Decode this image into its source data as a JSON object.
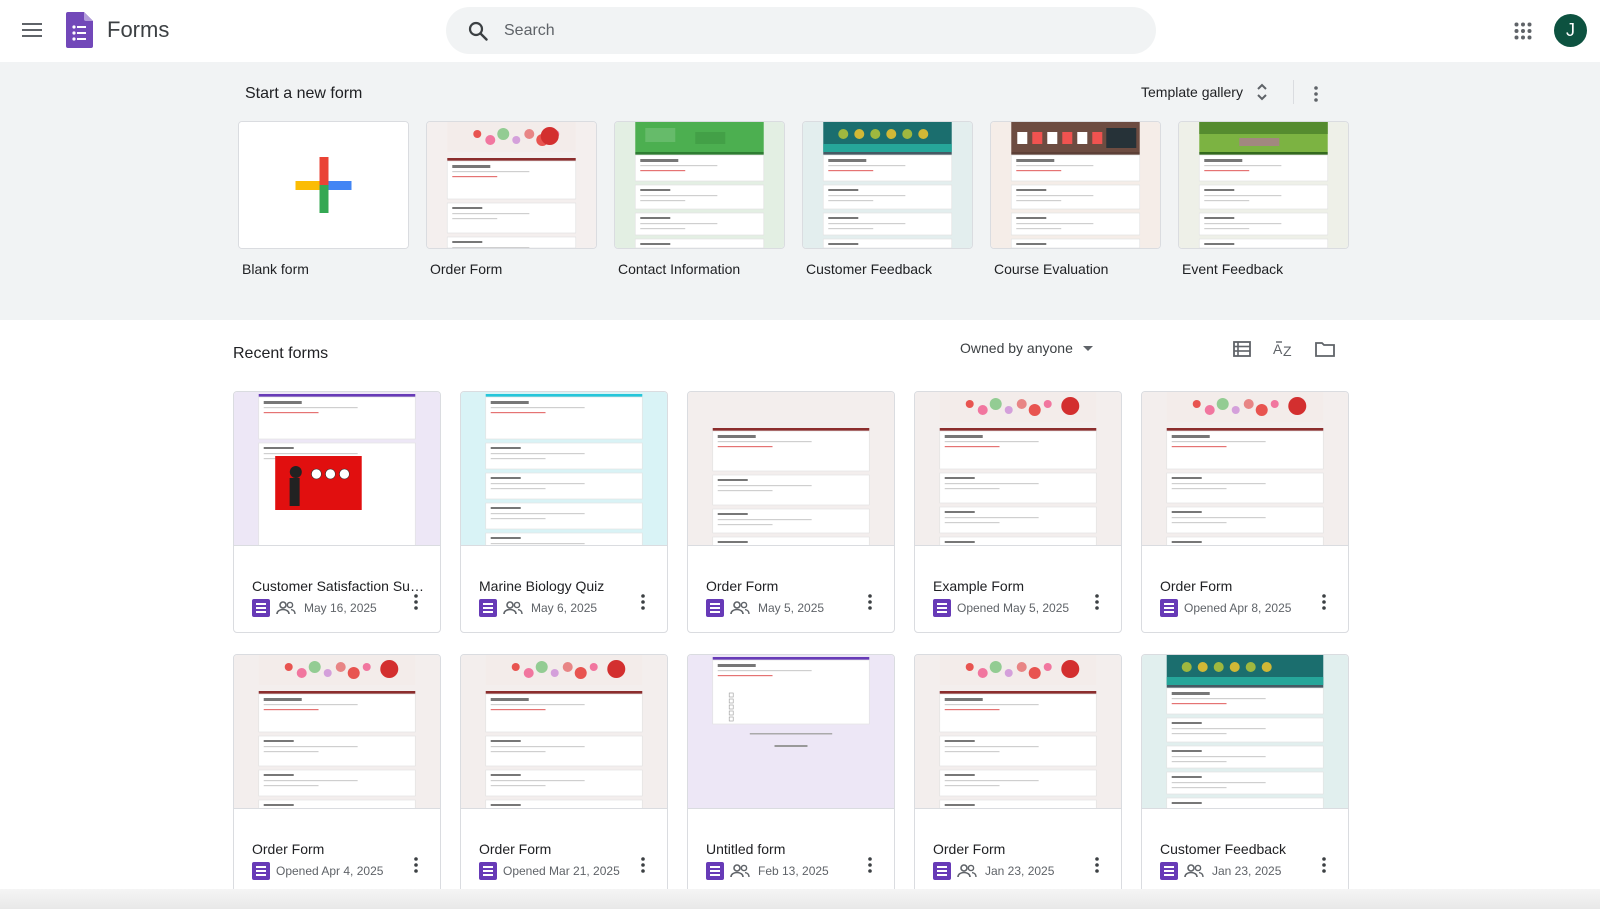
{
  "header": {
    "app_title": "Forms",
    "search_placeholder": "Search",
    "avatar_initial": "J"
  },
  "templates": {
    "heading": "Start a new form",
    "gallery_label": "Template gallery",
    "items": [
      {
        "name": "Blank form",
        "theme": "blank",
        "bg": "#ffffff"
      },
      {
        "name": "Order Form",
        "theme": "floral",
        "bg": "#f4efee"
      },
      {
        "name": "Contact Information",
        "theme": "green",
        "bg": "#e3efe3"
      },
      {
        "name": "Customer Feedback",
        "theme": "teal",
        "bg": "#e3eeee"
      },
      {
        "name": "Course Evaluation",
        "theme": "board",
        "bg": "#f5ede8"
      },
      {
        "name": "Event Feedback",
        "theme": "park",
        "bg": "#eef0e8"
      }
    ]
  },
  "recent": {
    "heading": "Recent forms",
    "owner_filter": "Owned by anyone",
    "forms": [
      {
        "title": "Customer Satisfaction Survey",
        "date": "May 16, 2025",
        "shared": true,
        "theme": "survey"
      },
      {
        "title": "Marine Biology Quiz",
        "date": "May 6, 2025",
        "shared": true,
        "theme": "quiz"
      },
      {
        "title": "Order Form",
        "date": "May 5, 2025",
        "shared": true,
        "theme": "order-plain"
      },
      {
        "title": "Example Form",
        "date": "Opened May 5, 2025",
        "shared": false,
        "theme": "floral"
      },
      {
        "title": "Order Form",
        "date": "Opened Apr 8, 2025",
        "shared": false,
        "theme": "floral"
      },
      {
        "title": "Order Form",
        "date": "Opened Apr 4, 2025",
        "shared": false,
        "theme": "floral"
      },
      {
        "title": "Order Form",
        "date": "Opened Mar 21, 2025",
        "shared": false,
        "theme": "floral"
      },
      {
        "title": "Untitled form",
        "date": "Feb 13, 2025",
        "shared": true,
        "theme": "untitled"
      },
      {
        "title": "Order Form",
        "date": "Jan 23, 2025",
        "shared": true,
        "theme": "floral"
      },
      {
        "title": "Customer Feedback",
        "date": "Jan 23, 2025",
        "shared": true,
        "theme": "teal"
      }
    ]
  },
  "colors": {
    "forms_purple": "#673ab7",
    "avatar_green": "#0d5240",
    "template_bg": "#f1f3f4"
  }
}
